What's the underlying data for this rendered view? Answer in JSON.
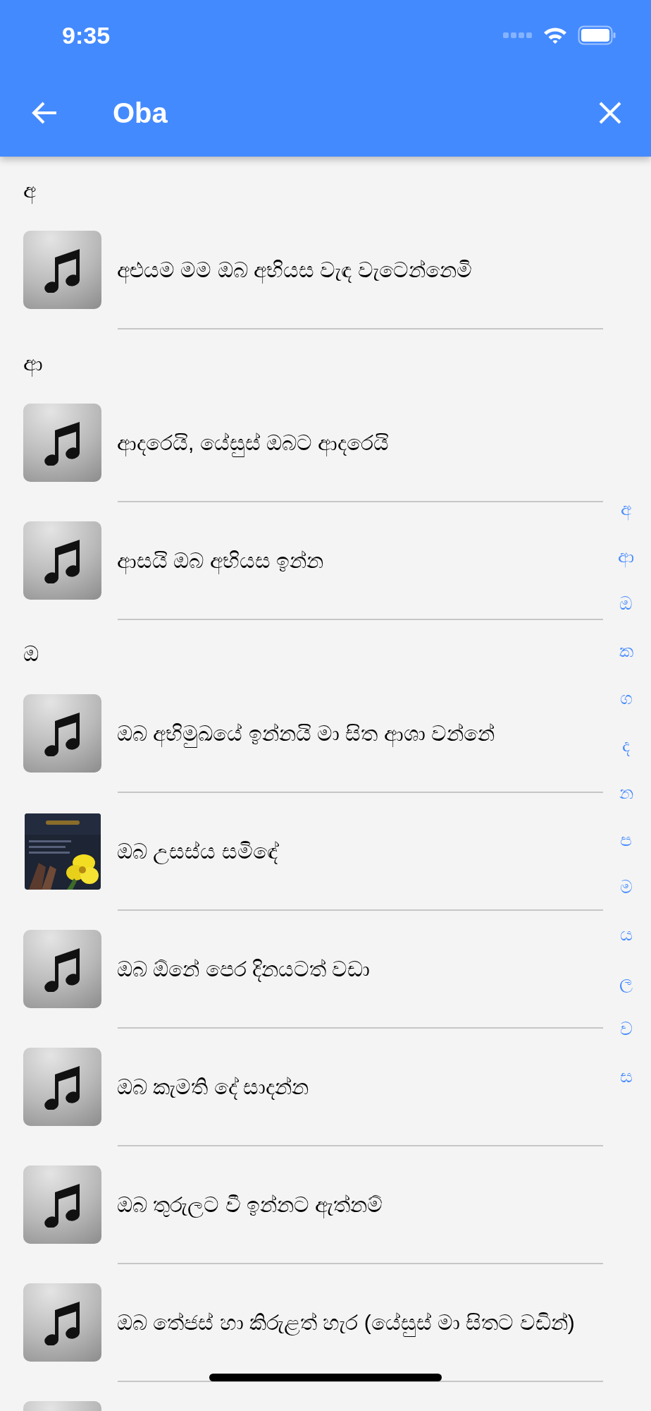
{
  "status_bar": {
    "time": "9:35"
  },
  "header": {
    "title": "Oba"
  },
  "sections": [
    {
      "letter": "අ",
      "songs": [
        {
          "kind": "music",
          "title": "අළුයම මම ඔබ අභියස වැඳ වැටෙන්නෙමි"
        }
      ]
    },
    {
      "letter": "ආ",
      "songs": [
        {
          "kind": "music",
          "title": "ආදරෙයි, යේසුස් ඔබට ආදරෙයි"
        },
        {
          "kind": "music",
          "title": "ආසයි ඔබ අභියස ඉන්න"
        }
      ]
    },
    {
      "letter": "ඔ",
      "songs": [
        {
          "kind": "music",
          "title": "ඔබ අභිමුඛයේ ඉන්නයි මා සිත ආශා වන්නේ"
        },
        {
          "kind": "picture",
          "title": "ඔබ උසස්ය සමිඳේ"
        },
        {
          "kind": "music",
          "title": "ඔබ ඕනේ පෙර දිනයටත් වඩා"
        },
        {
          "kind": "music",
          "title": "ඔබ කැමති දේ සාදන්න"
        },
        {
          "kind": "music",
          "title": "ඔබ තුරුලට වී ඉන්නට ඇත්නම්"
        },
        {
          "kind": "music",
          "title": "ඔබ තේජස් හා කිරුළත් හැර (යේසුස් මා සිතට වඩින්)"
        },
        {
          "kind": "blank_tile"
        }
      ]
    }
  ],
  "index": [
    "අ",
    "ආ",
    "ඔ",
    "ක",
    "ග",
    "ද",
    "න",
    "ප",
    "ම",
    "ය",
    "ල",
    "ව",
    "ස"
  ]
}
